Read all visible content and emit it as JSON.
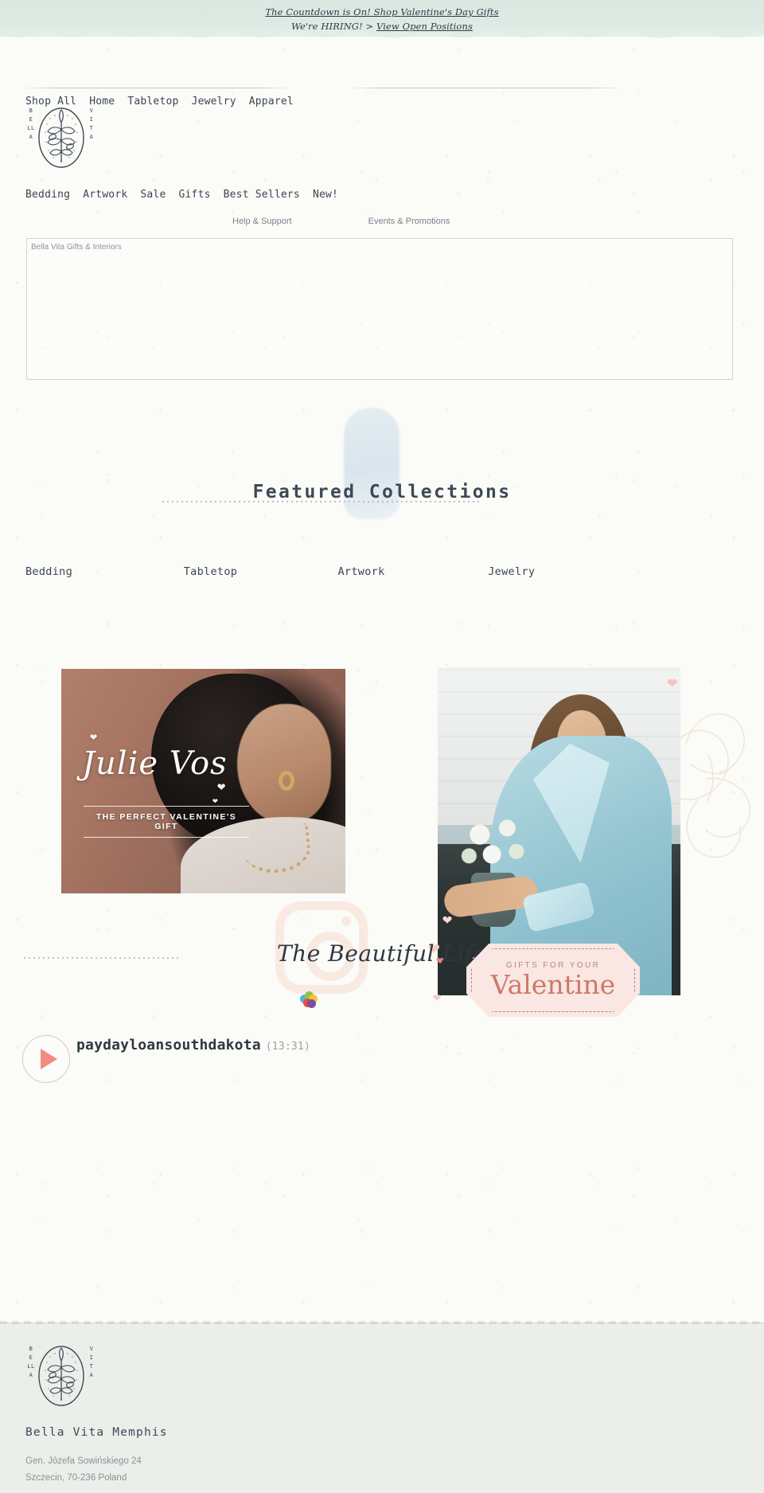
{
  "announcement": {
    "line1": "The Countdown is On! Shop Valentine's Day Gifts",
    "line2_prefix": "We're HIRING! > ",
    "line2_link": "View Open Positions"
  },
  "nav": {
    "primary": [
      "Shop All",
      "Home",
      "Tabletop",
      "Jewelry",
      "Apparel"
    ],
    "secondary": [
      "Bedding",
      "Artwork",
      "Sale",
      "Gifts",
      "Best Sellers",
      "New!"
    ],
    "utility": [
      "Help & Support",
      "Events & Promotions"
    ]
  },
  "logo": {
    "left_letters": "B\nE\nLL\nA",
    "right_letters": "V\nI\nT\nA",
    "icon": "leaf-oval-icon"
  },
  "embed": {
    "label": "Bella Vita Gifts & Interiors"
  },
  "featured": {
    "title": "Featured Collections",
    "collections": [
      "Bedding",
      "Tabletop",
      "Artwork",
      "Jewelry"
    ]
  },
  "promos": {
    "left": {
      "script_title": "Julie Vos",
      "tagline": "THE PERFECT VALENTINE'S GIFT"
    },
    "right": {
      "card_kicker": "GIFTS FOR YOUR",
      "card_title": "Valentine"
    }
  },
  "instagram": {
    "script": "The Beautiful Life",
    "icon": "instagram-icon"
  },
  "player": {
    "track_title": "paydayloansouthdakota",
    "duration": "(13:31)",
    "play_icon": "play-icon"
  },
  "footer": {
    "brand": "Bella Vita Memphis",
    "address_line1": "Gen. Józefa Sowińskiego 24",
    "address_line2": "Szczecin, 70-236 Poland"
  },
  "colors": {
    "announce_bg": "#dce8e2",
    "ink": "#3d4955",
    "muted": "#8a9198",
    "valentine_pink": "#fae6e2",
    "valentine_text": "#cc7a69",
    "play_accent": "#f28c82",
    "footer_bg": "#eceeea"
  }
}
